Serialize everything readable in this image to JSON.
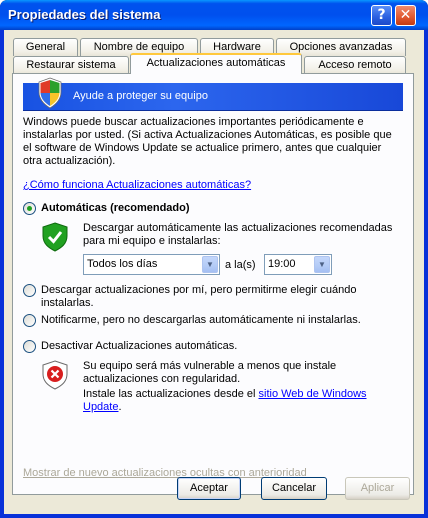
{
  "window": {
    "title": "Propiedades del sistema",
    "help_glyph": "?",
    "close_glyph": "✕"
  },
  "tabs_row1": [
    "General",
    "Nombre de equipo",
    "Hardware",
    "Opciones avanzadas"
  ],
  "tabs_row2": [
    "Restaurar sistema",
    "Actualizaciones automáticas",
    "Acceso remoto"
  ],
  "active_tab": "Actualizaciones automáticas",
  "banner": {
    "text": "Ayude a proteger su equipo",
    "icon": "security-shield-icon"
  },
  "intro": "Windows puede buscar actualizaciones importantes periódicamente e instalarlas por usted. (Si activa Actualizaciones Automáticas, es posible que el software de Windows Update se actualice primero, antes que cualquier otra actualización).",
  "how_link": "¿Cómo funciona Actualizaciones automáticas?",
  "options": {
    "automatic": {
      "label": "Automáticas (recomendado)",
      "selected": true,
      "description": "Descargar automáticamente las actualizaciones recomendadas para mi equipo e instalarlas:",
      "day_value": "Todos los días",
      "at_label": "a la(s)",
      "time_value": "19:00"
    },
    "download_only": {
      "label": "Descargar actualizaciones por mí, pero permitirme elegir cuándo instalarlas.",
      "selected": false
    },
    "notify_only": {
      "label": "Notificarme, pero no descargarlas automáticamente ni instalarlas.",
      "selected": false
    },
    "disable": {
      "label": "Desactivar Actualizaciones automáticas.",
      "selected": false,
      "warning": "Su equipo será más vulnerable a menos que instale actualizaciones con regularidad.",
      "install_prefix": "Instale las actualizaciones desde el ",
      "install_link": "sitio Web de Windows Update",
      "install_suffix": "."
    }
  },
  "hidden_link": "Mostrar de nuevo actualizaciones ocultas con anterioridad",
  "buttons": {
    "ok": "Aceptar",
    "cancel": "Cancelar",
    "apply": "Aplicar"
  },
  "colors": {
    "titlebar": "#0053ee",
    "banner": "#2c66ee",
    "shield_green": "#21a121",
    "shield_red": "#d81e1e",
    "link": "#0000ff"
  }
}
